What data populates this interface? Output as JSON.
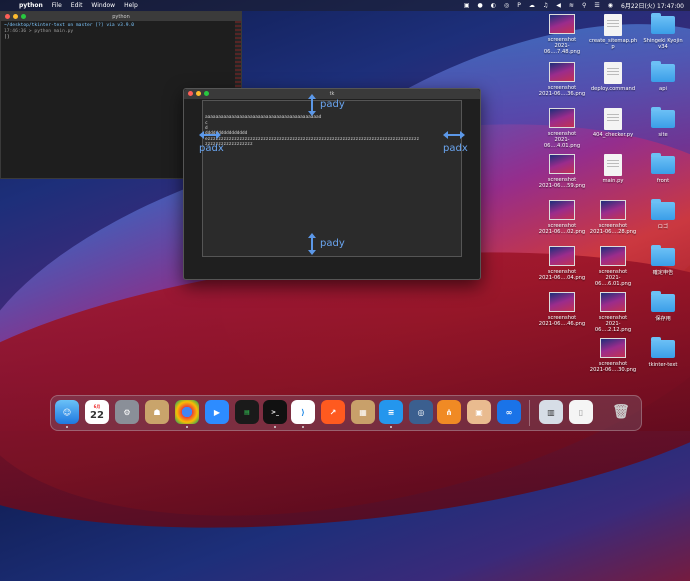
{
  "menubar": {
    "app_name": "python",
    "menus": [
      "File",
      "Edit",
      "Window",
      "Help"
    ],
    "datetime": "6月22日(火)  17:47:00"
  },
  "terminal": {
    "title": "python",
    "line1": "~/desktop/tkinter-text on  master [?] via  v3.9.0",
    "line2": "17:46:36 > python main.py",
    "line3": "[]"
  },
  "tk_window": {
    "title": "tk",
    "lines": [
      "aaaaaaaaaaaaaaaaaaaaaaaaaaaaaaaaaaaaaaaaaaad",
      "c",
      "d",
      "dddddddddddddddd",
      "ezzzzzzzzzzzzzzzzzzzzzzzzzzzzzzzzzzzzzzzzzzzzzzzzzzzzzzzzzzzzzzzzzzzzzzzzzzzzzzzz",
      "zzzzzzzzzzzzzzzzzz"
    ],
    "labels": {
      "pady_top": "pady",
      "pady_bottom": "pady",
      "padx_left": "padx",
      "padx_right": "padx"
    }
  },
  "desktop_icons": [
    {
      "label1": "screenshot",
      "label2": "2021-06....7.48.png"
    },
    {
      "label1": "create_sitemap.ph",
      "label2": "p"
    },
    {
      "label1": "Shingeki Kyojin",
      "label2": "v34"
    },
    {
      "label1": "screenshot",
      "label2": "2021-06....36.png"
    },
    {
      "label1": "deploy.command",
      "label2": ""
    },
    {
      "label1": "api",
      "label2": ""
    },
    {
      "label1": "screenshot",
      "label2": "2021-06....4.01.png"
    },
    {
      "label1": "404_checker.py",
      "label2": ""
    },
    {
      "label1": "site",
      "label2": ""
    },
    {
      "label1": "screenshot",
      "label2": "2021-06....59.png"
    },
    {
      "label1": "main.py",
      "label2": ""
    },
    {
      "label1": "front",
      "label2": ""
    },
    {
      "label1": "screenshot",
      "label2": "2021-06....02.png"
    },
    {
      "label1": "screenshot",
      "label2": "2021-06....28.png"
    },
    {
      "label1": "ロゴ",
      "label2": ""
    },
    {
      "label1": "screenshot",
      "label2": "2021-06....04.png"
    },
    {
      "label1": "screenshot",
      "label2": "2021-06....6.01.png"
    },
    {
      "label1": "確定申告",
      "label2": ""
    },
    {
      "label1": "screenshot",
      "label2": "2021-06....46.png"
    },
    {
      "label1": "screenshot",
      "label2": "2021-06....2.12.png"
    },
    {
      "label1": "保存用",
      "label2": ""
    },
    {
      "label1": "screenshot",
      "label2": "2021-06....30.png"
    },
    {
      "label1": "tkinter-text",
      "label2": ""
    }
  ],
  "dock": {
    "calendar_day": "22",
    "calendar_month": "6月"
  },
  "colors": {
    "annotation": "#6aa5f0",
    "folder": "#3a9ee8"
  }
}
